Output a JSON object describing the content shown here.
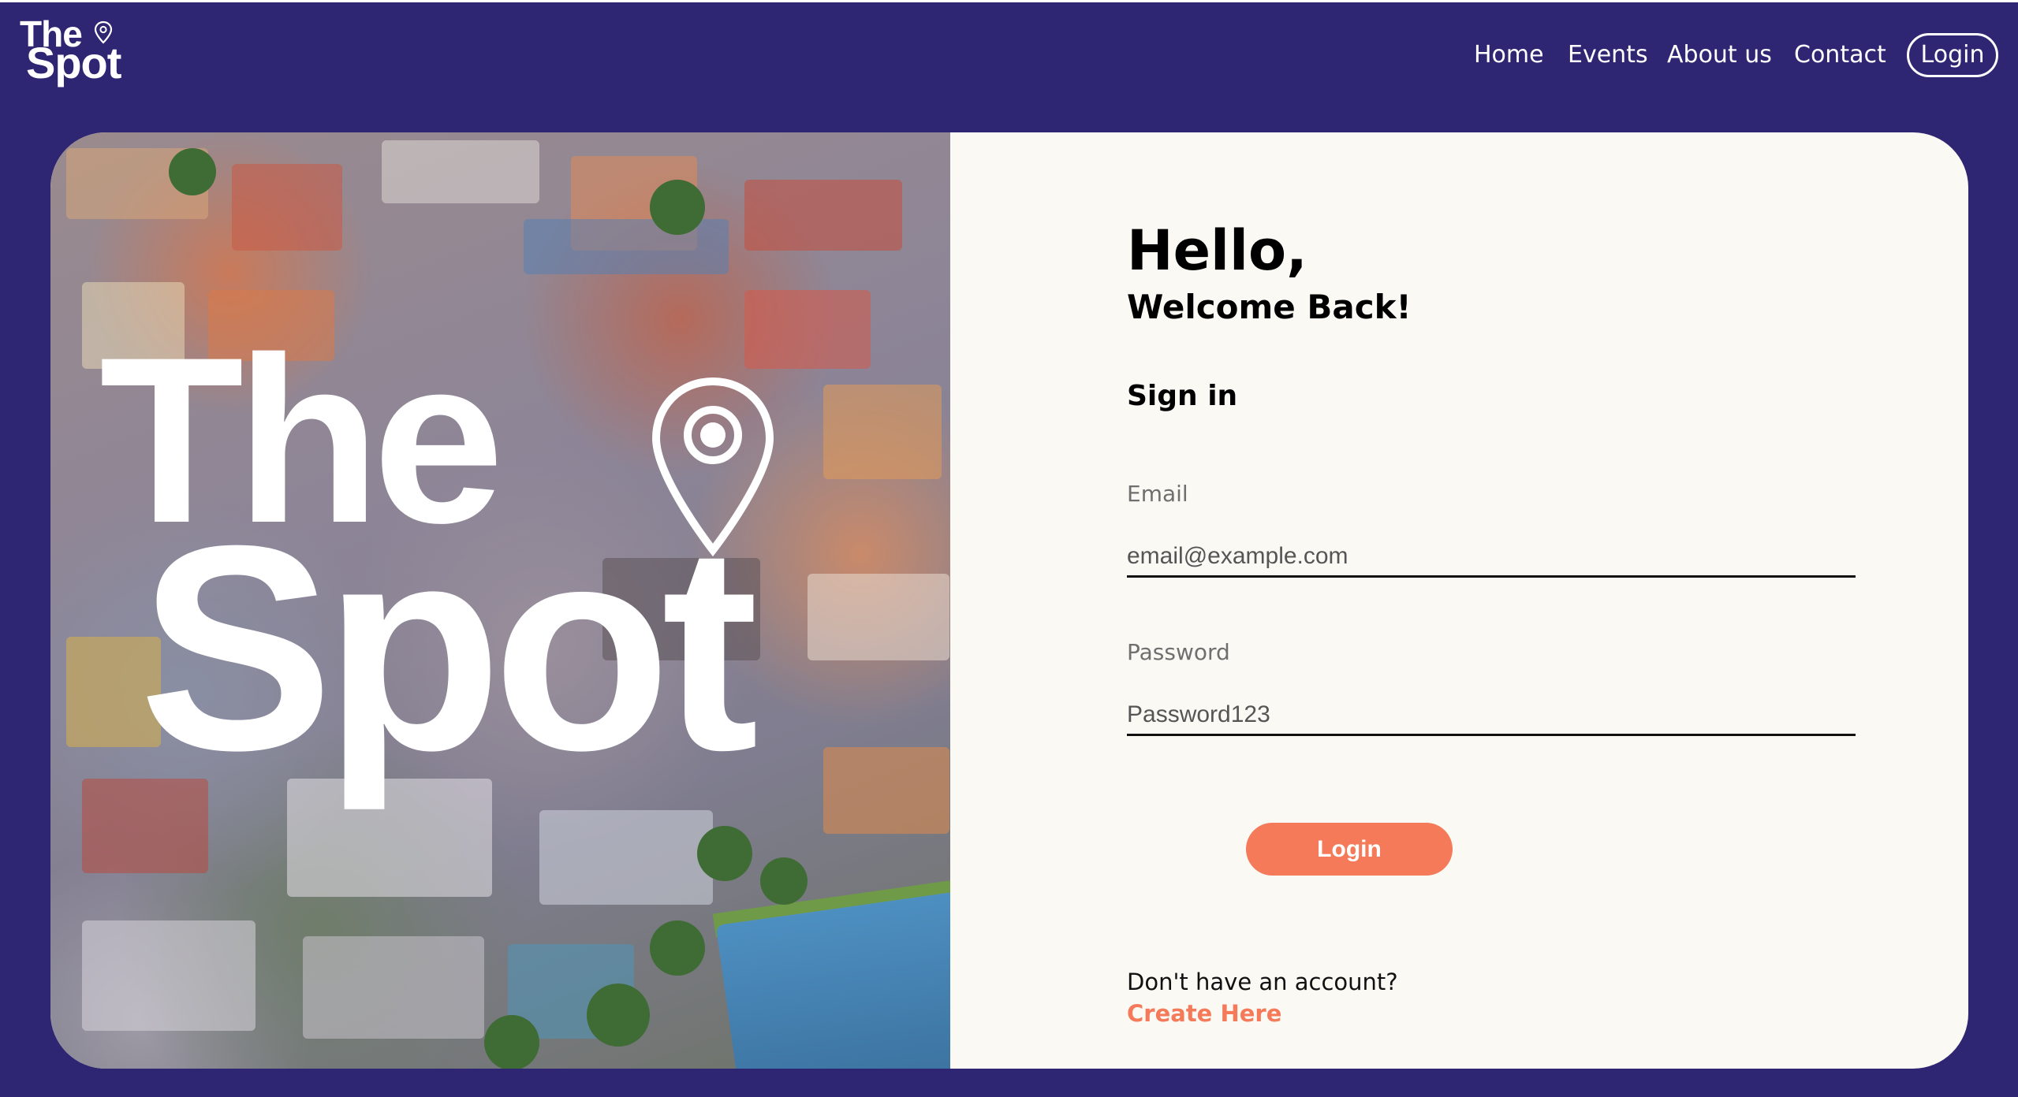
{
  "header": {
    "logo": {
      "line1": "The",
      "line2": "Spot"
    },
    "nav": [
      "Home",
      "Events",
      "About us",
      "Contact"
    ],
    "login_label": "Login"
  },
  "hero": {
    "title_line1": "The",
    "title_line2": "Spot"
  },
  "form": {
    "greeting": "Hello,",
    "subgreeting": "Welcome Back!",
    "heading": "Sign in",
    "email_label": "Email",
    "email_placeholder": "email@example.com",
    "password_label": "Password",
    "password_placeholder": "Password123",
    "submit_label": "Login",
    "no_account_text": "Don't have an account?",
    "create_link": "Create Here"
  },
  "colors": {
    "background": "#2e2672",
    "accent": "#f47a5a",
    "card": "#fbf9f4"
  }
}
